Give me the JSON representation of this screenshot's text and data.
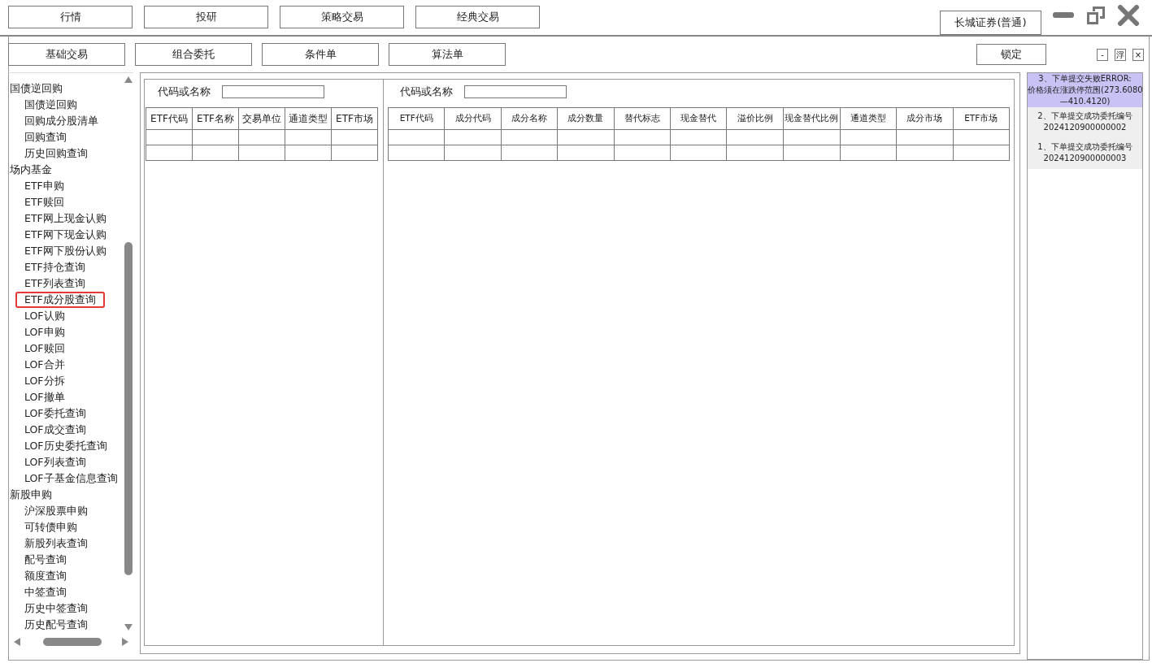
{
  "top_tabs": [
    {
      "label": "行情",
      "selected": false
    },
    {
      "label": "投研",
      "selected": false
    },
    {
      "label": "策略交易",
      "selected": false
    },
    {
      "label": "经典交易",
      "selected": false
    }
  ],
  "broker_button": "长城证券(普通)",
  "sub_tabs": [
    {
      "label": "基础交易",
      "selected": false
    },
    {
      "label": "组合委托",
      "selected": false
    },
    {
      "label": "条件单",
      "selected": false
    },
    {
      "label": "算法单",
      "selected": false
    }
  ],
  "lock_button": "锁定",
  "panel_buttons": [
    "-",
    "浮",
    "×"
  ],
  "sidebar": {
    "items": [
      {
        "label": "国债逆回购",
        "children": [
          {
            "label": "国债逆回购",
            "selected": false
          },
          {
            "label": "回购成分股清单",
            "selected": false
          },
          {
            "label": "回购查询",
            "selected": false
          },
          {
            "label": "历史回购查询",
            "selected": false
          }
        ]
      },
      {
        "label": "场内基金",
        "children": [
          {
            "label": "ETF申购",
            "selected": false
          },
          {
            "label": "ETF赎回",
            "selected": false
          },
          {
            "label": "ETF网上现金认购",
            "selected": false
          },
          {
            "label": "ETF网下现金认购",
            "selected": false
          },
          {
            "label": "ETF网下股份认购",
            "selected": false
          },
          {
            "label": "ETF持仓查询",
            "selected": false
          },
          {
            "label": "ETF列表查询",
            "selected": false
          },
          {
            "label": "ETF成分股查询",
            "selected": true
          },
          {
            "label": "LOF认购",
            "selected": false
          },
          {
            "label": "LOF申购",
            "selected": false
          },
          {
            "label": "LOF赎回",
            "selected": false
          },
          {
            "label": "LOF合并",
            "selected": false
          },
          {
            "label": "LOF分拆",
            "selected": false
          },
          {
            "label": "LOF撤单",
            "selected": false
          },
          {
            "label": "LOF委托查询",
            "selected": false
          },
          {
            "label": "LOF成交查询",
            "selected": false
          },
          {
            "label": "LOF历史委托查询",
            "selected": false
          },
          {
            "label": "LOF列表查询",
            "selected": false
          },
          {
            "label": "LOF子基金信息查询",
            "selected": false
          }
        ]
      },
      {
        "label": "新股申购",
        "children": [
          {
            "label": "沪深股票申购",
            "selected": false
          },
          {
            "label": "可转债申购",
            "selected": false
          },
          {
            "label": "新股列表查询",
            "selected": false
          },
          {
            "label": "配号查询",
            "selected": false
          },
          {
            "label": "额度查询",
            "selected": false
          },
          {
            "label": "中签查询",
            "selected": false
          },
          {
            "label": "历史中签查询",
            "selected": false
          },
          {
            "label": "历史配号查询",
            "selected": false
          }
        ]
      }
    ]
  },
  "etf_panel": {
    "search_label": "代码或名称",
    "table": {
      "columns": [
        "ETF代码",
        "ETF名称",
        "交易单位",
        "通道类型",
        "ETF市场"
      ],
      "rows": [
        [
          "",
          "",
          "",
          "",
          ""
        ],
        [
          "",
          "",
          "",
          "",
          ""
        ]
      ]
    }
  },
  "component_panel": {
    "search_label": "代码或名称",
    "table": {
      "columns": [
        "ETF代码",
        "成分代码",
        "成分名称",
        "成分数量",
        "替代标志",
        "现金替代",
        "溢价比例",
        "现金替代比例",
        "通道类型",
        "成分市场",
        "ETF市场"
      ],
      "rows": [
        [
          "",
          "",
          "",
          "",
          "",
          "",
          "",
          "",
          "",
          "",
          ""
        ],
        [
          "",
          "",
          "",
          "",
          "",
          "",
          "",
          "",
          "",
          "",
          ""
        ]
      ]
    }
  },
  "messages": [
    {
      "kind": "error",
      "lines": [
        "3、下单提交失败ERROR:",
        "价格须在涨跌停范围(273.6080",
        "—410.4120)"
      ]
    },
    {
      "kind": "success",
      "lines": [
        "2、下单提交成功委托编号",
        "2024120900000002"
      ]
    },
    {
      "kind": "success",
      "lines": [
        "1、下单提交成功委托编号",
        "2024120900000003"
      ]
    }
  ]
}
